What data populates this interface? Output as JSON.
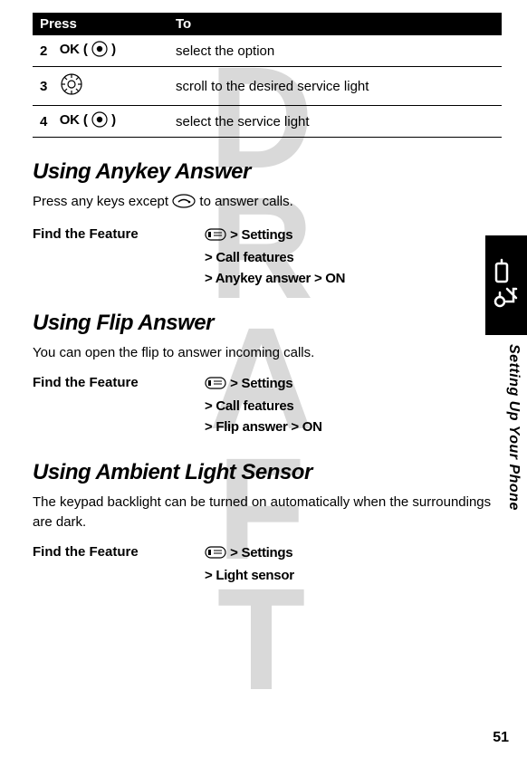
{
  "table": {
    "head_press": "Press",
    "head_to": "To",
    "rows": [
      {
        "num": "2",
        "press_label": "OK",
        "press_suffix": "(",
        "press_close": ")",
        "to": "select the option"
      },
      {
        "num": "3",
        "press_label": "",
        "to": "scroll to the desired service light"
      },
      {
        "num": "4",
        "press_label": "OK",
        "press_suffix": "(",
        "press_close": ")",
        "to": "select the service light"
      }
    ]
  },
  "sections": [
    {
      "heading": "Using Anykey Answer",
      "body_pre": "Press any keys except ",
      "body_post": " to answer calls.",
      "feature_label": "Find the Feature",
      "path_lines": [
        "> Settings",
        "> Call features",
        "> Anykey answer > ON"
      ]
    },
    {
      "heading": "Using Flip Answer",
      "body_pre": "You can open the flip to answer incoming calls.",
      "body_post": "",
      "feature_label": "Find the Feature",
      "path_lines": [
        "> Settings",
        "> Call features",
        "> Flip answer > ON"
      ]
    },
    {
      "heading": "Using Ambient Light Sensor",
      "body_pre": "The keypad backlight can be turned on automatically when the surroundings are dark.",
      "body_post": "",
      "feature_label": "Find the Feature",
      "path_lines": [
        "> Settings",
        "> Light sensor"
      ]
    }
  ],
  "side_label": "Setting Up Your Phone",
  "page_number": "51",
  "watermark": "DRAFT"
}
